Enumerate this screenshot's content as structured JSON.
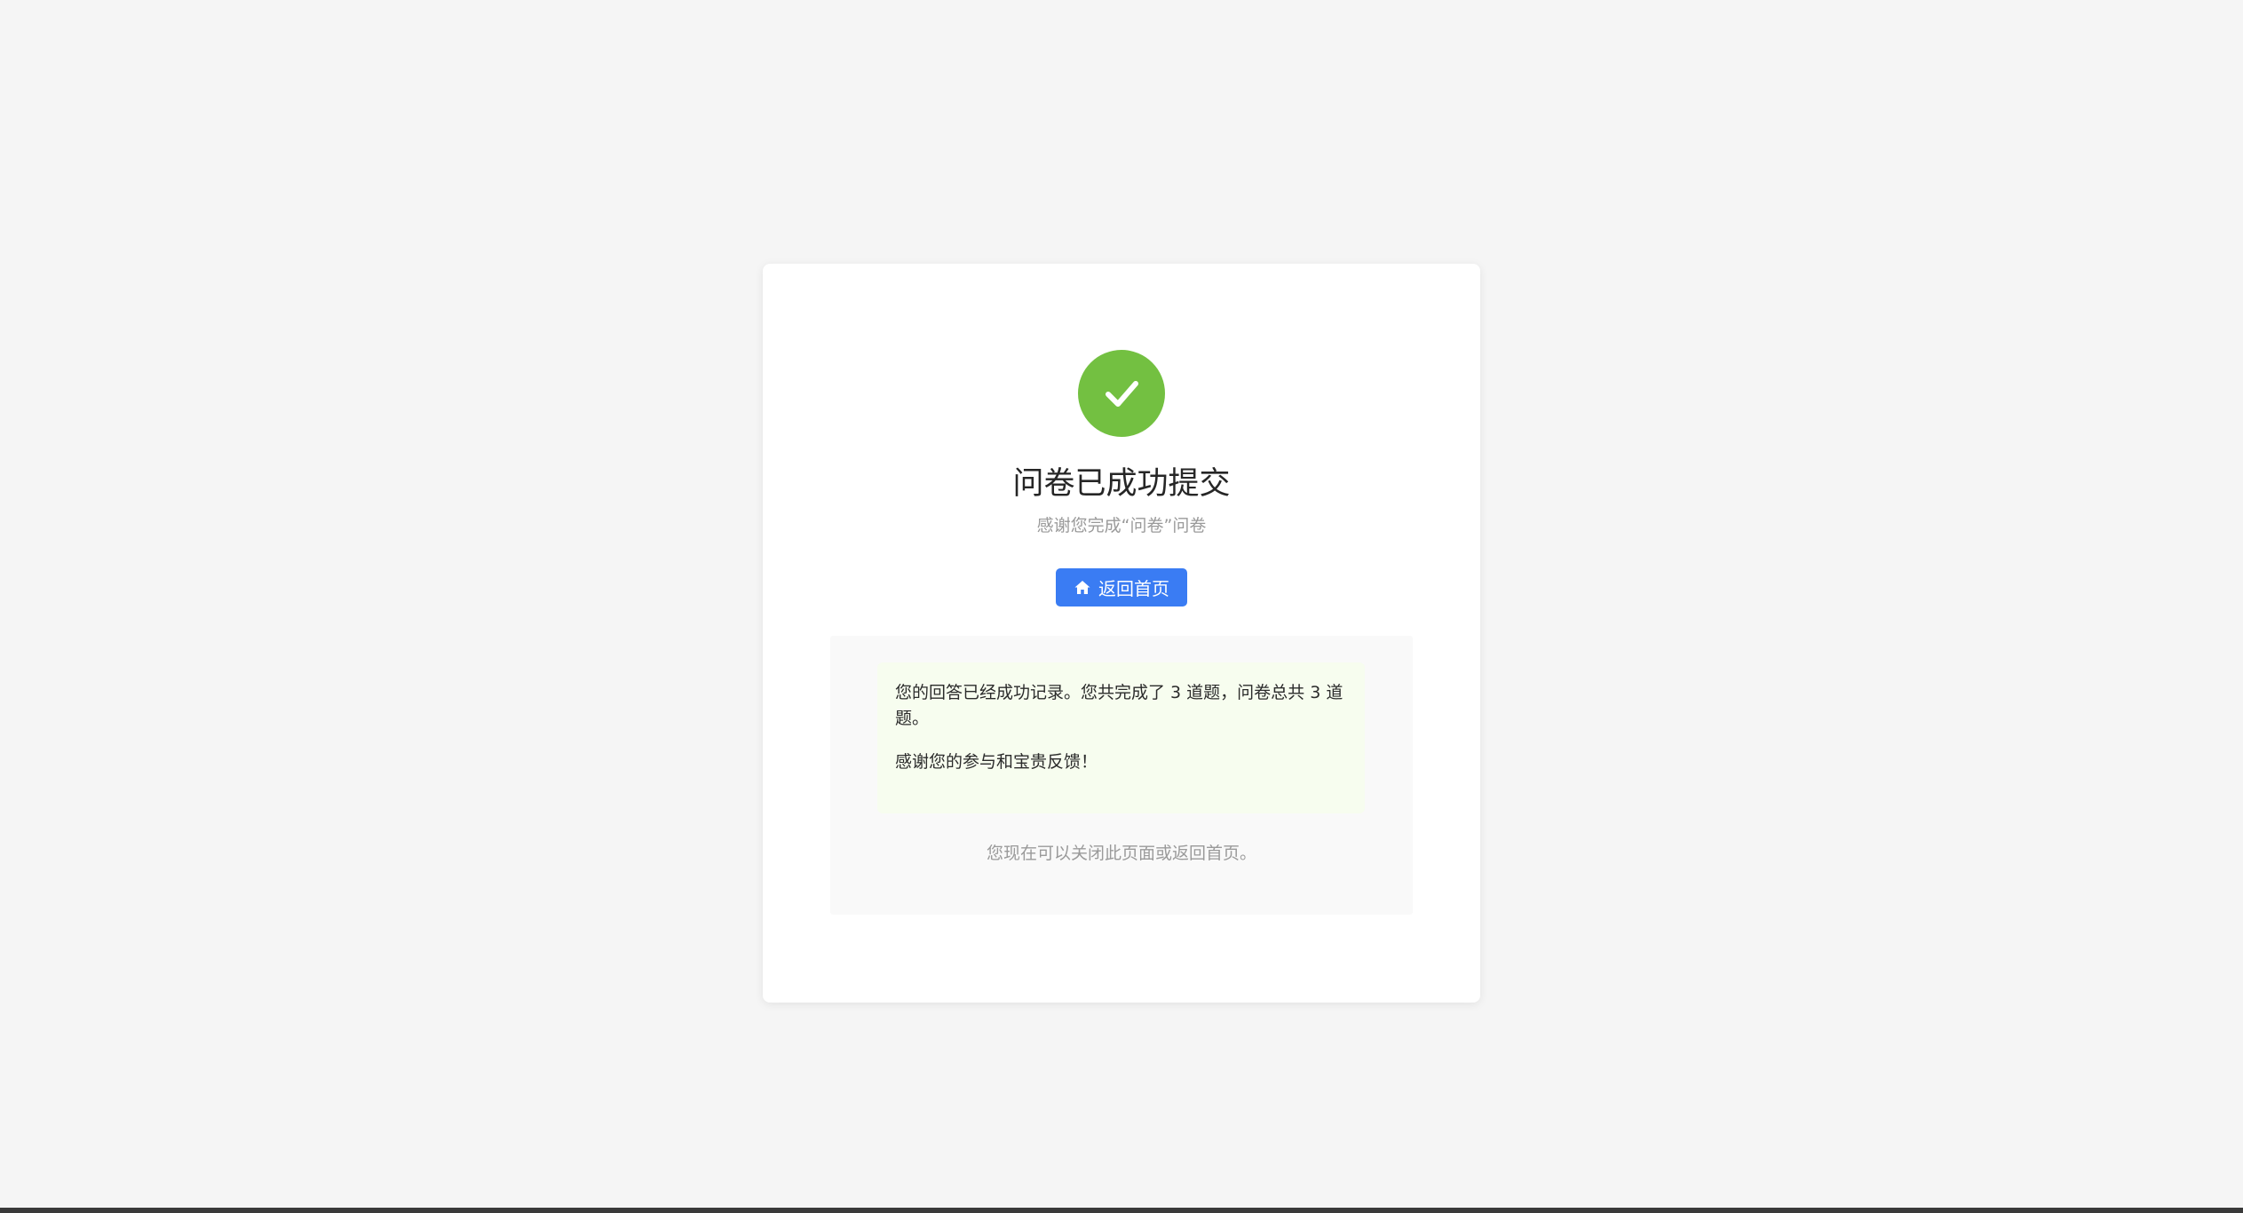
{
  "page": {
    "background_color": "#f5f5f5"
  },
  "success": {
    "icon": "check-circle-icon",
    "icon_color": "#73c041",
    "title": "问卷已成功提交",
    "subtitle": "感谢您完成“问卷”问卷"
  },
  "actions": {
    "home_button_label": "返回首页",
    "home_button_icon": "home-icon",
    "home_button_color": "#3a7cf3"
  },
  "result": {
    "summary": "您的回答已经成功记录。您共完成了 3 道题，问卷总共 3 道题。",
    "thanks": "感谢您的参与和宝贵反馈！",
    "box_color": "#f7fdef"
  },
  "footer": {
    "note": "您现在可以关闭此页面或返回首页。"
  }
}
